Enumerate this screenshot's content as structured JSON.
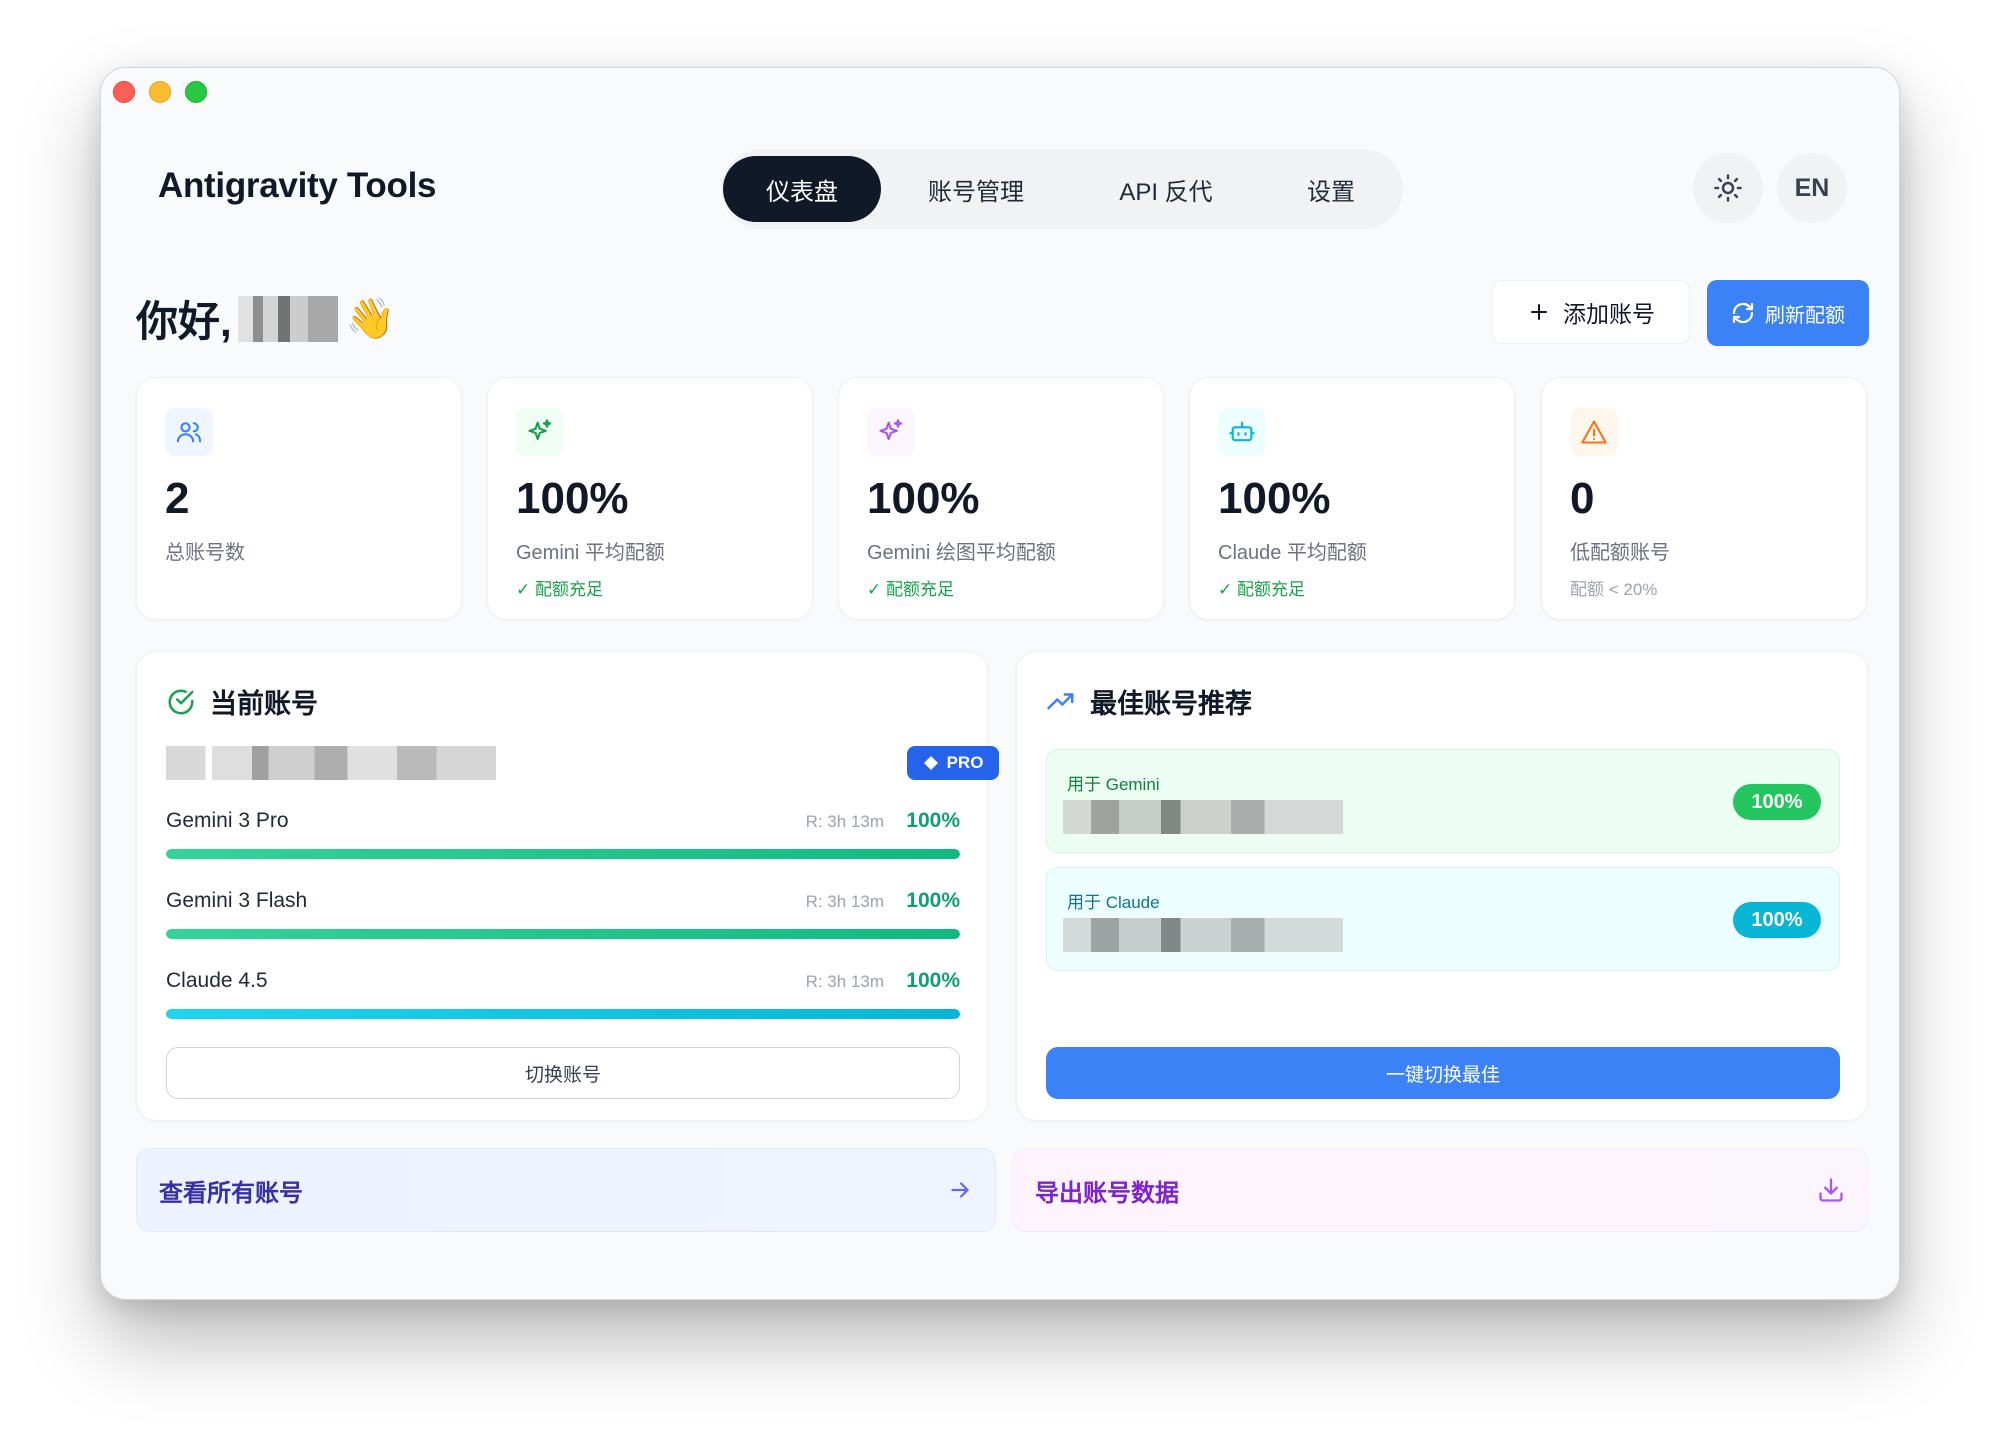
{
  "app": {
    "title": "Antigravity Tools"
  },
  "nav": {
    "tabs": [
      {
        "label": "仪表盘",
        "active": true
      },
      {
        "label": "账号管理",
        "active": false
      },
      {
        "label": "API 反代",
        "active": false
      },
      {
        "label": "设置",
        "active": false
      }
    ]
  },
  "header": {
    "theme_icon": "sun-icon",
    "language": "EN"
  },
  "greeting": {
    "text": "你好,",
    "emoji": "👋"
  },
  "toolbar": {
    "add_label": "添加账号",
    "refresh_label": "刷新配额"
  },
  "stats": [
    {
      "value": "2",
      "label": "总账号数",
      "sub": "",
      "icon": "users-icon",
      "color": "#3b82f6"
    },
    {
      "value": "100%",
      "label": "Gemini 平均配额",
      "sub": "✓ 配额充足",
      "icon": "sparkles-icon",
      "color": "#16a34a"
    },
    {
      "value": "100%",
      "label": "Gemini 绘图平均配额",
      "sub": "✓ 配额充足",
      "icon": "sparkles-icon",
      "color": "#a855f7"
    },
    {
      "value": "100%",
      "label": "Claude 平均配额",
      "sub": "✓ 配额充足",
      "icon": "bot-icon",
      "color": "#06b6d4"
    },
    {
      "value": "0",
      "label": "低配额账号",
      "sub": "配额 < 20%",
      "icon": "warning-icon",
      "color": "#f97316"
    }
  ],
  "current_account": {
    "title": "当前账号",
    "badge": "PRO",
    "quotas": [
      {
        "name": "Gemini 3 Pro",
        "reset": "R: 3h 13m",
        "percent": "100%",
        "fill": 1.0
      },
      {
        "name": "Gemini 3 Flash",
        "reset": "R: 3h 13m",
        "percent": "100%",
        "fill": 1.0
      },
      {
        "name": "Claude 4.5",
        "reset": "R: 3h 13m",
        "percent": "100%",
        "fill": 1.0
      }
    ],
    "switch_label": "切换账号"
  },
  "best_accounts": {
    "title": "最佳账号推荐",
    "items": [
      {
        "label": "用于 Gemini",
        "percent": "100%"
      },
      {
        "label": "用于 Claude",
        "percent": "100%"
      }
    ],
    "switch_label": "一键切换最佳"
  },
  "actions": {
    "view_all": "查看所有账号",
    "export": "导出账号数据"
  }
}
